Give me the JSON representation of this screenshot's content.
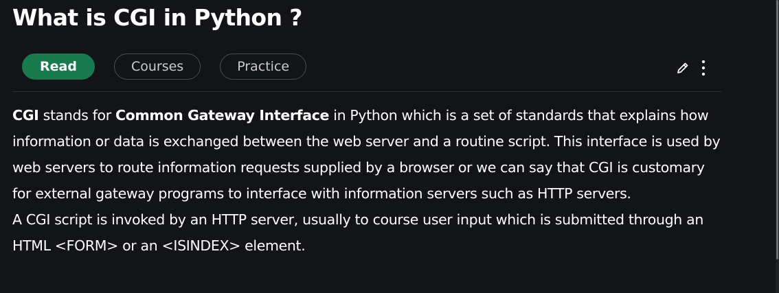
{
  "page": {
    "title": "What is CGI in Python ?"
  },
  "tabs": [
    {
      "label": "Read",
      "active": true
    },
    {
      "label": "Courses",
      "active": false
    },
    {
      "label": "Practice",
      "active": false
    }
  ],
  "actions": {
    "edit_icon": "pencil-icon",
    "more_icon": "vertical-dots-icon"
  },
  "article": {
    "p1_term": "CGI",
    "p1_text_a": " stands for ",
    "p1_bold_b": "Common Gateway Interface",
    "p1_text_c": " in Python which is a set of standards that explains how information or data is exchanged between the web server and a routine script. This interface is used by web servers to route information requests supplied by a browser or we can say that CGI is customary for external gateway programs to interface with information servers such as HTTP servers.",
    "p2_text": "A CGI script is invoked by an HTTP server, usually to course user input which is submitted through an HTML <FORM> or an <ISINDEX> element."
  },
  "colors": {
    "background": "#131417",
    "accent_green": "#1a7a4f",
    "text": "#ffffff",
    "muted_text": "#c9cbcf",
    "border": "#4a4d53"
  }
}
